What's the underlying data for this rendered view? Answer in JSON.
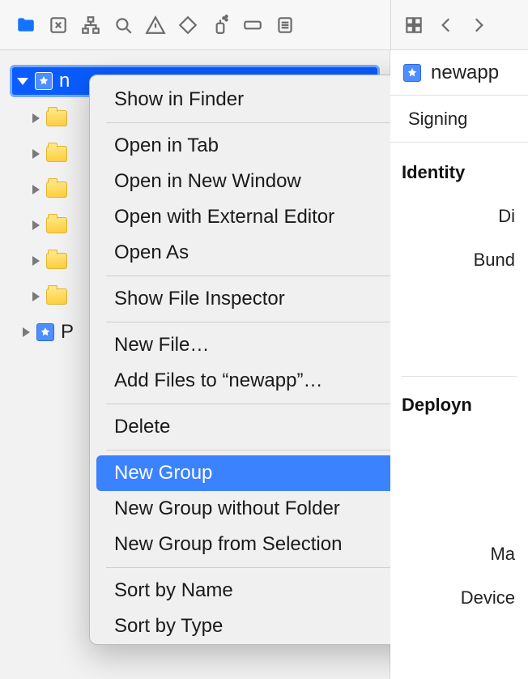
{
  "toolbar": {
    "icons": [
      "folder-icon",
      "close-box-icon",
      "hierarchy-icon",
      "search-icon",
      "warning-icon",
      "diamond-icon",
      "spray-icon",
      "tag-icon",
      "list-icon"
    ],
    "right_icons": [
      "grid-icon",
      "chevron-left-icon",
      "chevron-right-icon"
    ]
  },
  "project": {
    "name_first_char": "n",
    "tree_product_label": "P"
  },
  "context_menu": {
    "items": [
      {
        "label": "Show in Finder",
        "type": "item"
      },
      {
        "type": "sep"
      },
      {
        "label": "Open in Tab",
        "type": "item"
      },
      {
        "label": "Open in New Window",
        "type": "item"
      },
      {
        "label": "Open with External Editor",
        "type": "item"
      },
      {
        "label": "Open As",
        "type": "submenu"
      },
      {
        "type": "sep"
      },
      {
        "label": "Show File Inspector",
        "type": "item"
      },
      {
        "type": "sep"
      },
      {
        "label": "New File…",
        "type": "item"
      },
      {
        "label": "Add Files to “newapp”…",
        "type": "item"
      },
      {
        "type": "sep"
      },
      {
        "label": "Delete",
        "type": "item"
      },
      {
        "type": "sep"
      },
      {
        "label": "New Group",
        "type": "item",
        "hover": true
      },
      {
        "label": "New Group without Folder",
        "type": "item"
      },
      {
        "label": "New Group from Selection",
        "type": "item"
      },
      {
        "type": "sep"
      },
      {
        "label": "Sort by Name",
        "type": "item"
      },
      {
        "label": "Sort by Type",
        "type": "item"
      }
    ]
  },
  "inspector": {
    "title": "newapp",
    "tab_signing": "Signing",
    "section_identity": "Identity",
    "field_di": "Di",
    "field_bund": "Bund",
    "section_deploy": "Deployn",
    "field_ma": "Ma",
    "field_device": "Device"
  }
}
